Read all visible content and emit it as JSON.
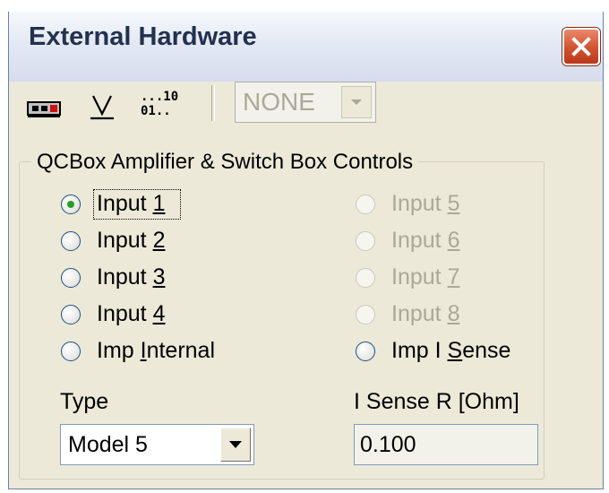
{
  "window": {
    "title": "External Hardware"
  },
  "toolbar": {
    "buttons": [
      {
        "icon": "hardware-box-icon"
      },
      {
        "icon": "voltage-v-icon"
      },
      {
        "icon": "digital-bits-icon",
        "top_text": "...10",
        "bottom_text": "01.."
      }
    ],
    "device_select": {
      "value": "NONE",
      "enabled": false
    }
  },
  "group": {
    "label": "QCBox Amplifier & Switch Box Controls",
    "radios": [
      {
        "pre": "Input ",
        "key": "1",
        "post": "",
        "checked": true,
        "enabled": true
      },
      {
        "pre": "Input ",
        "key": "2",
        "post": "",
        "checked": false,
        "enabled": true
      },
      {
        "pre": "Input ",
        "key": "3",
        "post": "",
        "checked": false,
        "enabled": true
      },
      {
        "pre": "Input ",
        "key": "4",
        "post": "",
        "checked": false,
        "enabled": true
      },
      {
        "pre": "Imp ",
        "key": "I",
        "post": "nternal",
        "checked": false,
        "enabled": true
      },
      {
        "pre": "Input ",
        "key": "5",
        "post": "",
        "checked": false,
        "enabled": false
      },
      {
        "pre": "Input ",
        "key": "6",
        "post": "",
        "checked": false,
        "enabled": false
      },
      {
        "pre": "Input ",
        "key": "7",
        "post": "",
        "checked": false,
        "enabled": false
      },
      {
        "pre": "Input ",
        "key": "8",
        "post": "",
        "checked": false,
        "enabled": false
      },
      {
        "pre": "Imp I ",
        "key": "S",
        "post": "ense",
        "checked": false,
        "enabled": true
      }
    ],
    "type_label": "Type",
    "type_value": "Model 5",
    "isense_label": "I Sense R [Ohm]",
    "isense_value": "0.100"
  },
  "colors": {
    "accent": "#21a121",
    "close_button": "#d2512e",
    "disabled_text": "#aca899",
    "window_face": "#ece9d8"
  }
}
